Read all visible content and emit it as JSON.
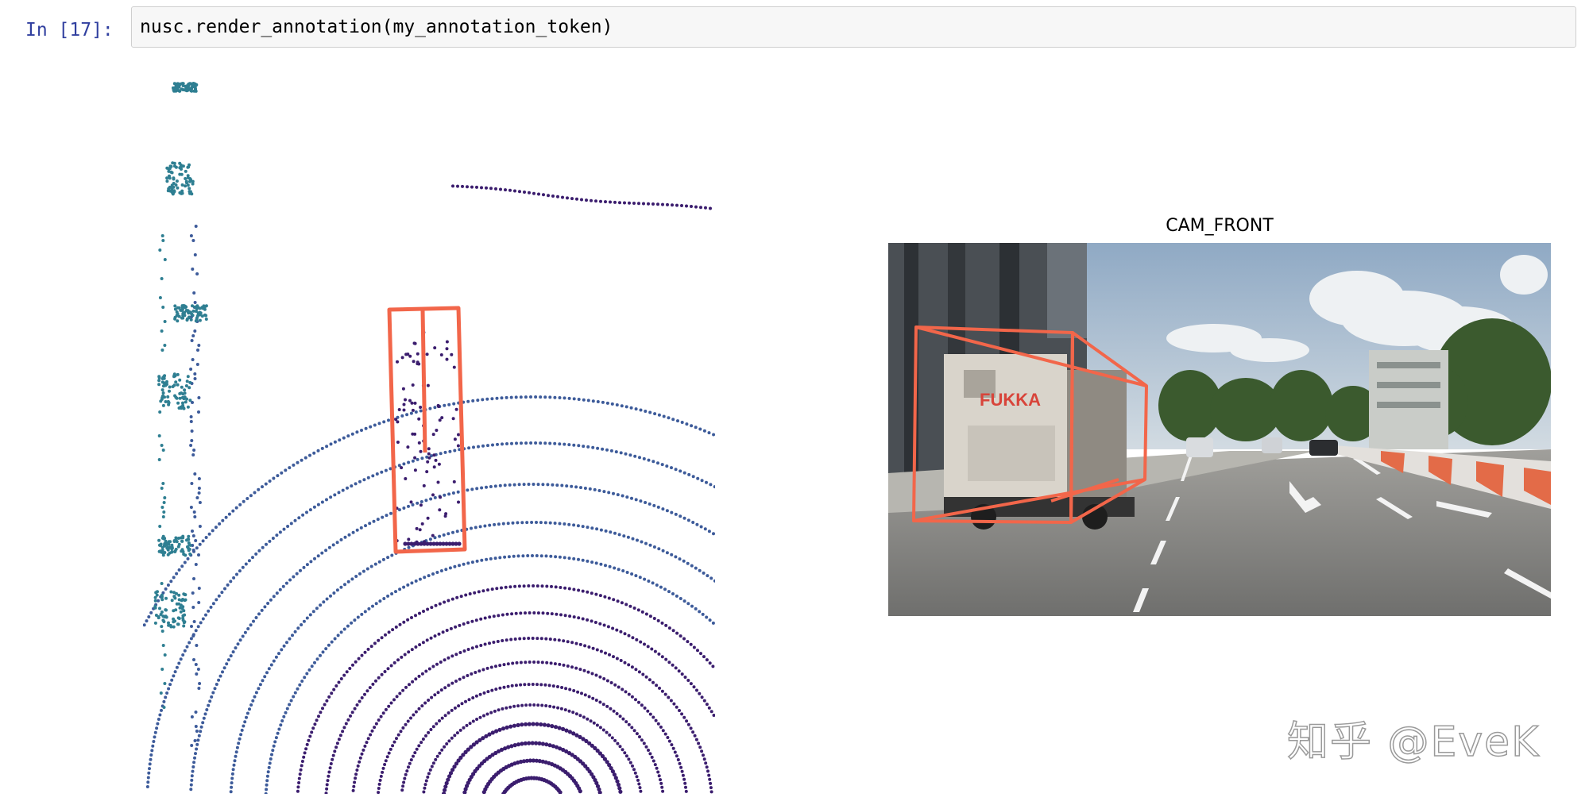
{
  "cell": {
    "prompt": "In [17]:",
    "code": "nusc.render_annotation(my_annotation_token)"
  },
  "lidar_view": {
    "colors": {
      "near_points": "#3b1d6e",
      "far_points": "#2f7f92",
      "mid_points": "#3d5b9a",
      "annotation_box": "#f2664a"
    }
  },
  "camera_view": {
    "title": "CAM_FRONT",
    "truck_sign": "FUKKA",
    "colors": {
      "annotation_box": "#f2664a",
      "sky": "#b9c8d8",
      "road": "#8f8f8f",
      "trees": "#3e5a2f"
    }
  },
  "watermark": "知乎 @EveK"
}
